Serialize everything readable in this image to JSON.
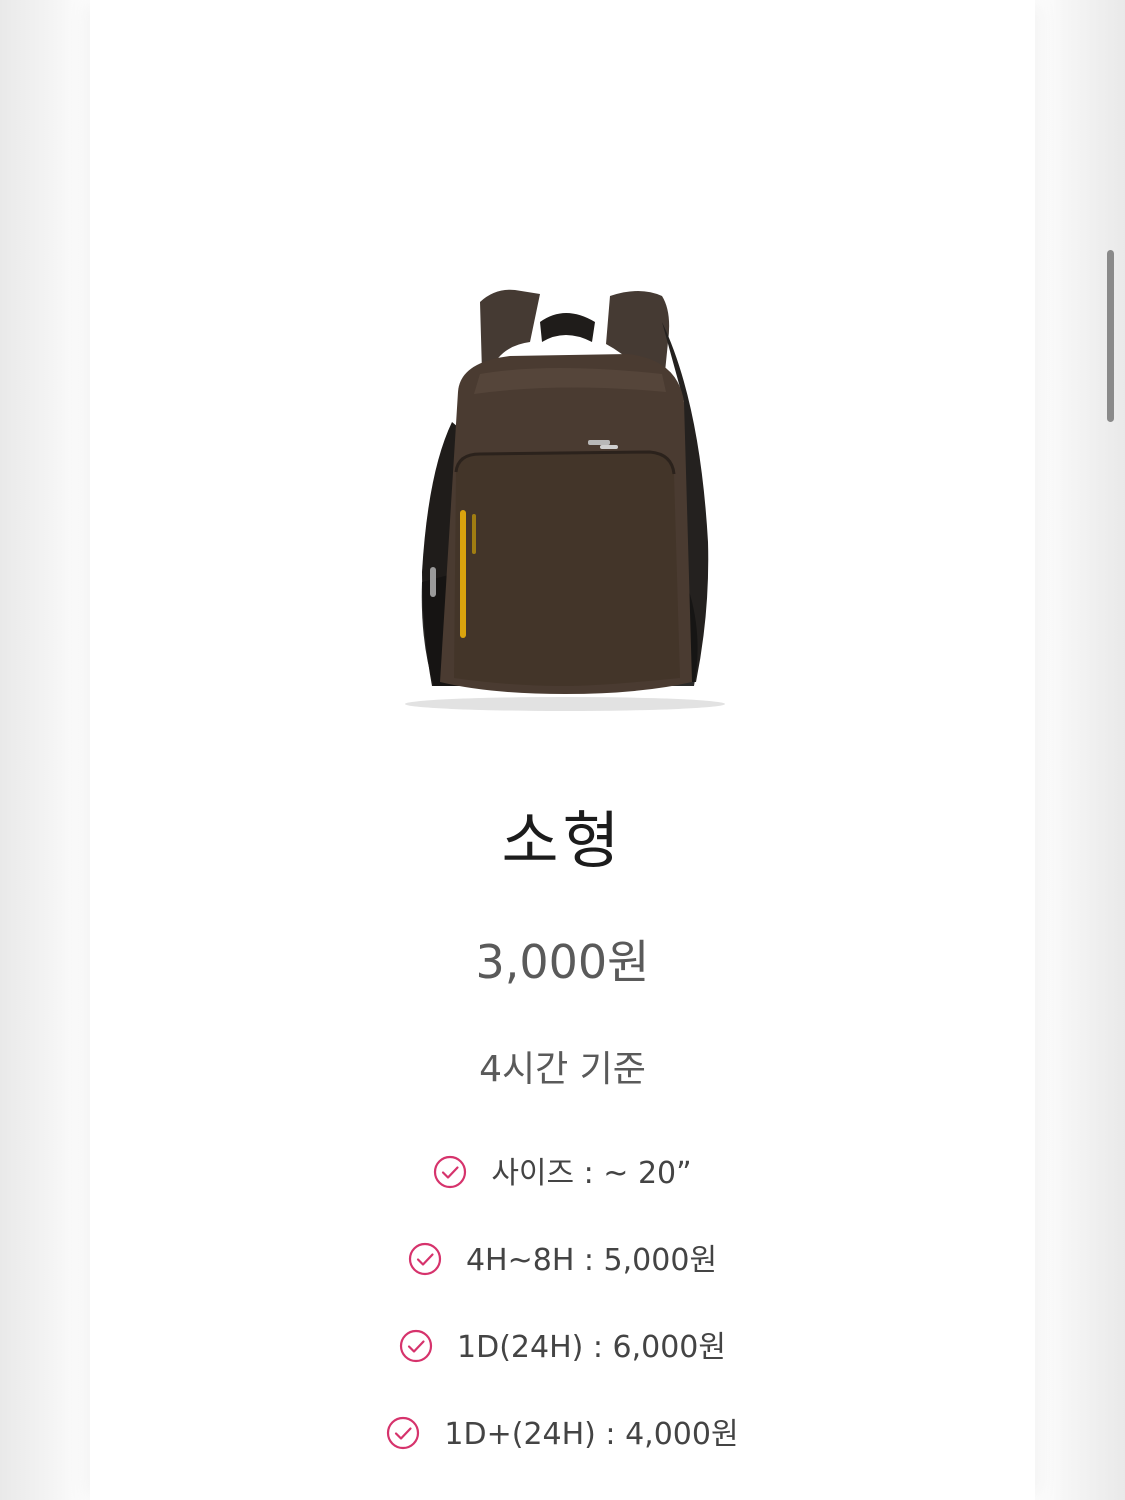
{
  "product": {
    "name": "소형",
    "price": "3,000원",
    "basis": "4시간 기준",
    "image_label": "backpack-image"
  },
  "features": [
    {
      "text": "사이즈 : ~ 20”"
    },
    {
      "text": "4H~8H : 5,000원"
    },
    {
      "text": "1D(24H) : 6,000원"
    },
    {
      "text": "1D+(24H) : 4,000원"
    }
  ],
  "colors": {
    "accent": "#d6336c",
    "bag_body": "#4a3b31",
    "bag_stripe": "#d9a30e"
  }
}
